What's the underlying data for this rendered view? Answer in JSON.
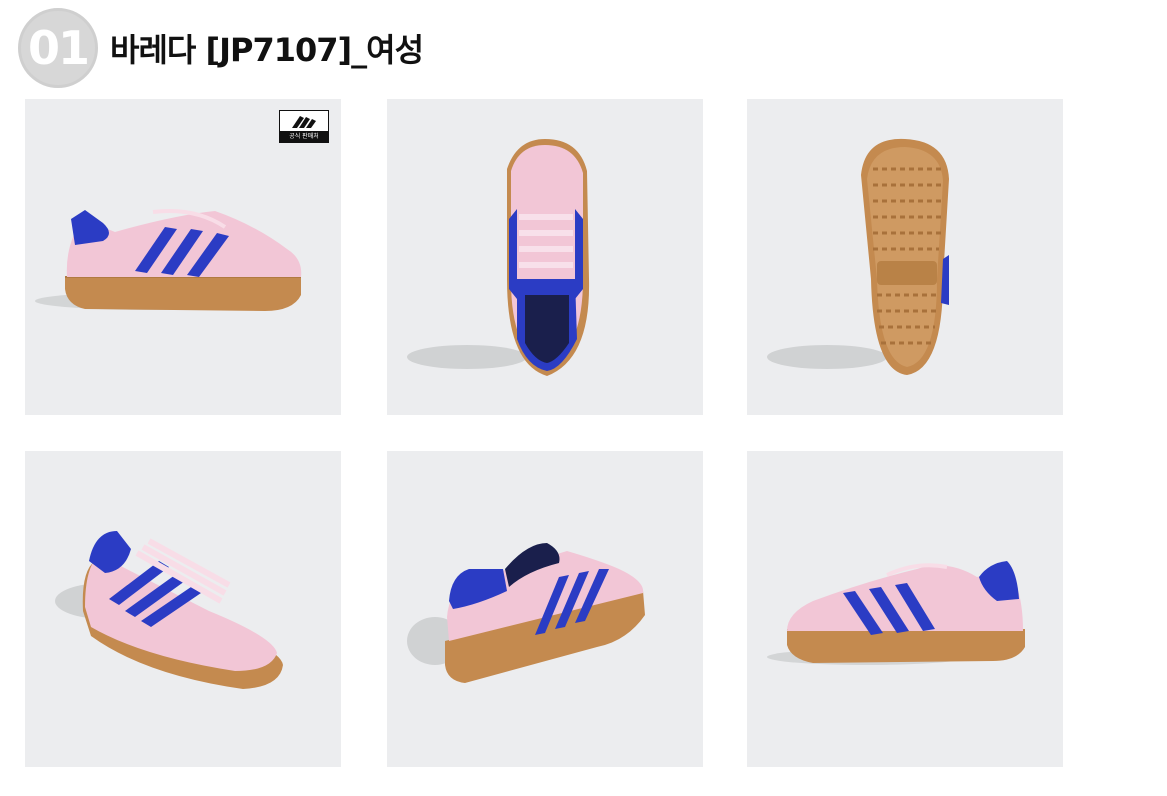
{
  "header": {
    "number": "01",
    "title": "바레다 [JP7107]_여성"
  },
  "gallery": {
    "badge": {
      "text": "공식 판매처",
      "logo": "adidas-logo-icon"
    },
    "images": [
      {
        "view": "side-lateral"
      },
      {
        "view": "top"
      },
      {
        "view": "sole"
      },
      {
        "view": "front-angle"
      },
      {
        "view": "back-angle"
      },
      {
        "view": "side-medial"
      }
    ]
  },
  "colors": {
    "upper": "#f2c6d6",
    "stripes": "#2b3cc4",
    "sole": "#c48a4f",
    "background": "#ecedef"
  }
}
